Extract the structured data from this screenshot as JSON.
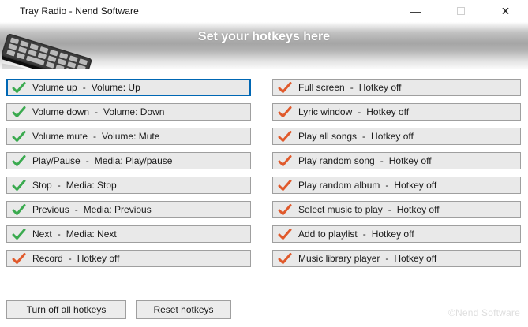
{
  "window": {
    "title": "Tray Radio - Nend Software",
    "controls": {
      "minimize": "—",
      "close": "✕"
    }
  },
  "banner": {
    "title": "Set your hotkeys here"
  },
  "hotkeys": {
    "separator": "-",
    "left": [
      {
        "label": "Volume up",
        "hotkey": "Volume: Up",
        "state": "on",
        "focused": true
      },
      {
        "label": "Volume down",
        "hotkey": "Volume: Down",
        "state": "on",
        "focused": false
      },
      {
        "label": "Volume mute",
        "hotkey": "Volume: Mute",
        "state": "on",
        "focused": false
      },
      {
        "label": "Play/Pause",
        "hotkey": "Media: Play/pause",
        "state": "on",
        "focused": false
      },
      {
        "label": "Stop",
        "hotkey": "Media: Stop",
        "state": "on",
        "focused": false
      },
      {
        "label": "Previous",
        "hotkey": "Media: Previous",
        "state": "on",
        "focused": false
      },
      {
        "label": "Next",
        "hotkey": "Media: Next",
        "state": "on",
        "focused": false
      },
      {
        "label": "Record",
        "hotkey": "Hotkey off",
        "state": "off",
        "focused": false
      }
    ],
    "right": [
      {
        "label": "Full screen",
        "hotkey": "Hotkey off",
        "state": "off",
        "focused": false
      },
      {
        "label": "Lyric window",
        "hotkey": "Hotkey off",
        "state": "off",
        "focused": false
      },
      {
        "label": "Play all songs",
        "hotkey": "Hotkey off",
        "state": "off",
        "focused": false
      },
      {
        "label": "Play random song",
        "hotkey": "Hotkey off",
        "state": "off",
        "focused": false
      },
      {
        "label": "Play random album",
        "hotkey": "Hotkey off",
        "state": "off",
        "focused": false
      },
      {
        "label": "Select music to play",
        "hotkey": "Hotkey off",
        "state": "off",
        "focused": false
      },
      {
        "label": "Add to playlist",
        "hotkey": "Hotkey off",
        "state": "off",
        "focused": false
      },
      {
        "label": "Music library player",
        "hotkey": "Hotkey off",
        "state": "off",
        "focused": false
      }
    ]
  },
  "footer": {
    "turn_off_label": "Turn off all hotkeys",
    "reset_label": "Reset hotkeys",
    "watermark": "©Nend Software"
  },
  "colors": {
    "check_on": "#3aaa4f",
    "check_off": "#e0592b",
    "focus_border": "#0067b4"
  }
}
